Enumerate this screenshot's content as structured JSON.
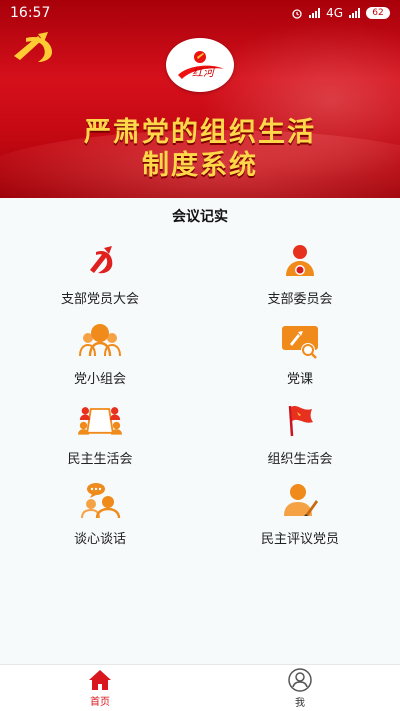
{
  "status_bar": {
    "time": "16:57",
    "network": "4G",
    "battery": "62"
  },
  "banner": {
    "title_line1": "严肃党的组织生活",
    "title_line2": "制度系统",
    "logo_text": "红河"
  },
  "section": {
    "title": "会议记实"
  },
  "menu_items": [
    {
      "label": "支部党员大会",
      "icon": "party-flag-icon"
    },
    {
      "label": "支部委员会",
      "icon": "committee-person-icon"
    },
    {
      "label": "党小组会",
      "icon": "group-people-icon"
    },
    {
      "label": "党课",
      "icon": "party-lesson-icon"
    },
    {
      "label": "民主生活会",
      "icon": "meeting-table-icon"
    },
    {
      "label": "组织生活会",
      "icon": "red-flag-icon"
    },
    {
      "label": "谈心谈话",
      "icon": "chat-people-icon"
    },
    {
      "label": "民主评议党员",
      "icon": "evaluate-person-icon"
    }
  ],
  "tab_bar": {
    "home_label": "首页",
    "me_label": "我"
  },
  "colors": {
    "primary_red": "#d8181e",
    "icon_orange": "#f08a1a",
    "title_gold": "#ffd84a"
  }
}
